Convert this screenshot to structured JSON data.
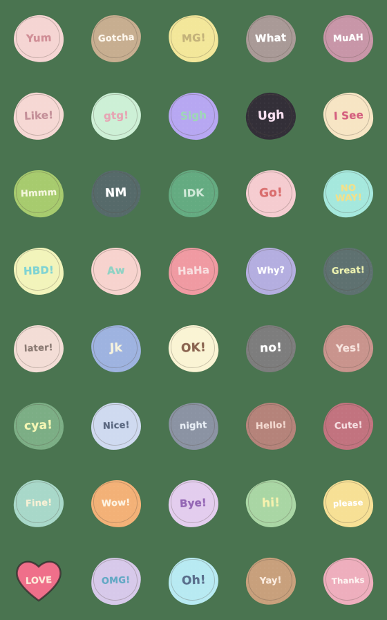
{
  "sheet": {
    "background": "#4a7450",
    "columns": 5,
    "rows": 8,
    "total_stickers": 40
  },
  "stickers": [
    {
      "id": "yum",
      "label": "Yum",
      "fill": "#f5d5d3",
      "text": "#d08e96",
      "shape": "blob",
      "size": "",
      "variant": "v1"
    },
    {
      "id": "gotcha",
      "label": "Gotcha",
      "fill": "#c7ae90",
      "text": "#fdf6ec",
      "shape": "blob",
      "size": "sm",
      "variant": "v2"
    },
    {
      "id": "mg",
      "label": "MG!",
      "fill": "#f3e79a",
      "text": "#c3b27a",
      "shape": "blob",
      "size": "",
      "variant": "v3"
    },
    {
      "id": "what",
      "label": "What",
      "fill": "#a99a97",
      "text": "#ffffff",
      "shape": "blob",
      "size": "",
      "variant": "v4"
    },
    {
      "id": "muah",
      "label": "MuAH",
      "fill": "#c896a8",
      "text": "#ffffff",
      "shape": "blob",
      "size": "sm",
      "variant": "v5"
    },
    {
      "id": "like",
      "label": "Like!",
      "fill": "#f6d8d4",
      "text": "#c49099",
      "shape": "blob",
      "size": "",
      "variant": "v2"
    },
    {
      "id": "gtg",
      "label": "gtg!",
      "fill": "#cdf0d6",
      "text": "#e6a6b4",
      "shape": "blob",
      "size": "",
      "variant": "v6"
    },
    {
      "id": "sigh",
      "label": "Sigh",
      "fill": "#b7a7f2",
      "text": "#9fd6b8",
      "shape": "blob",
      "size": "",
      "variant": "v1"
    },
    {
      "id": "ugh",
      "label": "Ugh",
      "fill": "#332f38",
      "text": "#f7dff0",
      "shape": "blob",
      "size": "lg",
      "variant": "v4"
    },
    {
      "id": "isee",
      "label": "I See",
      "fill": "#f7e5c4",
      "text": "#d4607f",
      "shape": "blob",
      "size": "",
      "variant": "v3"
    },
    {
      "id": "hmmm",
      "label": "Hmmm",
      "fill": "#a7cb6e",
      "text": "#f4f6dd",
      "shape": "blob",
      "size": "sm",
      "variant": "v5"
    },
    {
      "id": "nm",
      "label": "NM",
      "fill": "#566a6a",
      "text": "#ffffff",
      "shape": "blob",
      "size": "lg",
      "variant": "v2"
    },
    {
      "id": "idk",
      "label": "IDK",
      "fill": "#64ab81",
      "text": "#cfe8d7",
      "shape": "blob",
      "size": "",
      "variant": "v6"
    },
    {
      "id": "go",
      "label": "Go!",
      "fill": "#f5ccd0",
      "text": "#d96d6d",
      "shape": "blob",
      "size": "lg",
      "variant": "v1"
    },
    {
      "id": "noway",
      "label": "NO\nWAY!",
      "fill": "#a5e8dd",
      "text": "#f2e08a",
      "shape": "blob",
      "size": "two",
      "variant": "v4"
    },
    {
      "id": "hbd",
      "label": "HBD!",
      "fill": "#f2f4bb",
      "text": "#7fd3d3",
      "shape": "blob",
      "size": "",
      "variant": "v3"
    },
    {
      "id": "aw",
      "label": "Aw",
      "fill": "#f7d3ce",
      "text": "#8fd2c4",
      "shape": "blob",
      "size": "",
      "variant": "v5"
    },
    {
      "id": "haha",
      "label": "HaHa",
      "fill": "#f09aa2",
      "text": "#f8dfe0",
      "shape": "blob",
      "size": "",
      "variant": "v2"
    },
    {
      "id": "why",
      "label": "Why?",
      "fill": "#b4aee0",
      "text": "#ffffff",
      "shape": "blob",
      "size": "sm",
      "variant": "v6"
    },
    {
      "id": "great",
      "label": "Great!",
      "fill": "#5e7170",
      "text": "#edf2b0",
      "shape": "blob",
      "size": "sm",
      "variant": "v1"
    },
    {
      "id": "later",
      "label": "later!",
      "fill": "#f3ddd6",
      "text": "#8c7b74",
      "shape": "blob",
      "size": "sm",
      "variant": "v4"
    },
    {
      "id": "jk",
      "label": "Jk",
      "fill": "#9eb3e0",
      "text": "#f7f3dd",
      "shape": "blob",
      "size": "lg",
      "variant": "v3"
    },
    {
      "id": "ok",
      "label": "OK!",
      "fill": "#faf4d4",
      "text": "#8a6450",
      "shape": "blob",
      "size": "lg",
      "variant": "v5"
    },
    {
      "id": "no",
      "label": "no!",
      "fill": "#7d7d7d",
      "text": "#ffffff",
      "shape": "blob",
      "size": "lg",
      "variant": "v2"
    },
    {
      "id": "yes",
      "label": "Yes!",
      "fill": "#c9948d",
      "text": "#f7e3dd",
      "shape": "blob",
      "size": "",
      "variant": "v6"
    },
    {
      "id": "cya",
      "label": "cya!",
      "fill": "#7cae85",
      "text": "#f4f6b4",
      "shape": "blob",
      "size": "lg",
      "variant": "v1"
    },
    {
      "id": "nice",
      "label": "Nice!",
      "fill": "#cfdaf0",
      "text": "#5a6780",
      "shape": "blob",
      "size": "sm",
      "variant": "v4"
    },
    {
      "id": "night",
      "label": "night",
      "fill": "#8b93a3",
      "text": "#e8eef5",
      "shape": "blob",
      "size": "sm",
      "variant": "v3"
    },
    {
      "id": "hello",
      "label": "Hello!",
      "fill": "#b5837a",
      "text": "#f3d9d0",
      "shape": "blob",
      "size": "sm",
      "variant": "v5"
    },
    {
      "id": "cute",
      "label": "Cute!",
      "fill": "#c2737f",
      "text": "#f6dfe2",
      "shape": "blob",
      "size": "sm",
      "variant": "v2"
    },
    {
      "id": "fine",
      "label": "Fine!",
      "fill": "#a8d8c9",
      "text": "#f7f0d5",
      "shape": "blob",
      "size": "sm",
      "variant": "v6"
    },
    {
      "id": "wow",
      "label": "Wow!",
      "fill": "#f3b177",
      "text": "#fdf3e2",
      "shape": "blob",
      "size": "sm",
      "variant": "v1"
    },
    {
      "id": "bye",
      "label": "Bye!",
      "fill": "#e3cdee",
      "text": "#9467b5",
      "shape": "blob",
      "size": "",
      "variant": "v4"
    },
    {
      "id": "hi",
      "label": "hi!",
      "fill": "#a9d6a4",
      "text": "#f6f2ae",
      "shape": "blob",
      "size": "lg",
      "variant": "v3"
    },
    {
      "id": "please",
      "label": "please",
      "fill": "#f7e095",
      "text": "#ffffff",
      "shape": "blob",
      "size": "xs",
      "variant": "v5"
    },
    {
      "id": "love",
      "label": "LOVE",
      "fill": "#ef6f8a",
      "text": "#fdeadb",
      "shape": "heart",
      "size": "sm",
      "variant": "v1"
    },
    {
      "id": "omg",
      "label": "OMG!",
      "fill": "#d7c9ea",
      "text": "#62a8c4",
      "shape": "blob",
      "size": "sm",
      "variant": "v2"
    },
    {
      "id": "oh",
      "label": "Oh!",
      "fill": "#b8eaf2",
      "text": "#5a6f8c",
      "shape": "blob",
      "size": "lg",
      "variant": "v6"
    },
    {
      "id": "yay",
      "label": "Yay!",
      "fill": "#c8a07c",
      "text": "#fbece0",
      "shape": "blob",
      "size": "sm",
      "variant": "v4"
    },
    {
      "id": "thanks",
      "label": "Thanks",
      "fill": "#eeaebd",
      "text": "#fdf3f1",
      "shape": "blob",
      "size": "xs",
      "variant": "v3"
    }
  ]
}
